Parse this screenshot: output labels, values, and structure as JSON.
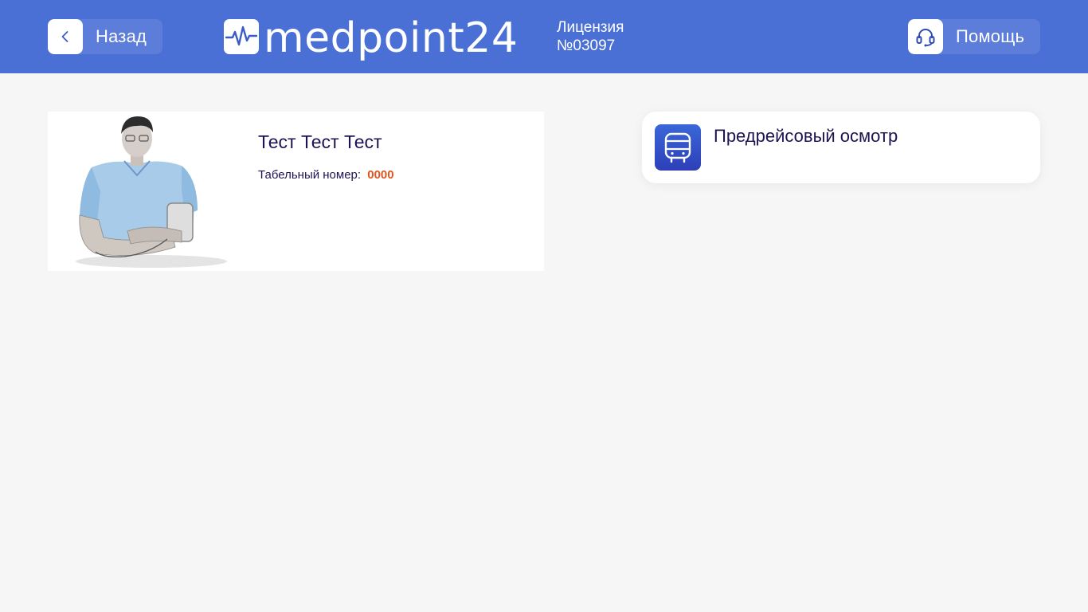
{
  "header": {
    "back_label": "Назад",
    "brand_name": "medpoint24",
    "license_line1": "Лицензия",
    "license_line2": "№03097",
    "help_label": "Помощь",
    "background_color": "#4a6fd5"
  },
  "profile": {
    "name": "Тест Тест Тест",
    "personnel_label": "Табельный номер:",
    "personnel_number": "0000",
    "number_color": "#e0551e"
  },
  "exams": [
    {
      "title": "Предрейсовый осмотр",
      "icon": "bus-icon"
    }
  ],
  "icons": {
    "back": "chevron-left-icon",
    "logo": "heartbeat-icon",
    "help": "headset-icon",
    "photo": "person-photo"
  }
}
